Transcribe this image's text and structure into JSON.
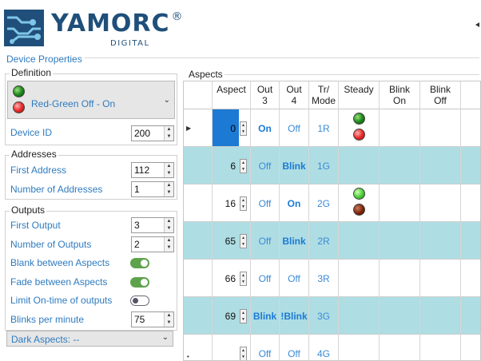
{
  "header": {
    "logo_text": "YAMORC",
    "logo_registered": "®",
    "logo_subtitle": "DIGITAL",
    "colors": {
      "brand": "#1f4f7a",
      "accent": "#2f7bbf"
    }
  },
  "device_properties": {
    "title": "Device Properties",
    "definition": {
      "title": "Definition",
      "selected": "Red-Green Off - On",
      "leds": [
        "green",
        "red"
      ],
      "device_id_label": "Device ID",
      "device_id_value": "200"
    },
    "addresses": {
      "title": "Addresses",
      "first_address_label": "First Address",
      "first_address_value": "112",
      "number_label": "Number of Addresses",
      "number_value": "1"
    },
    "outputs": {
      "title": "Outputs",
      "first_output_label": "First Output",
      "first_output_value": "3",
      "number_label": "Number of Outputs",
      "number_value": "2",
      "blank_label": "Blank between Aspects",
      "blank_on": true,
      "fade_label": "Fade between Aspects",
      "fade_on": true,
      "limit_label": "Limit On-time of outputs",
      "limit_on": false,
      "blinks_label": "Blinks per minute",
      "blinks_value": "75"
    },
    "dark_aspects": "Dark Aspects: --"
  },
  "aspects": {
    "title": "Aspects",
    "headers": {
      "aspect": "Aspect",
      "out3_a": "Out",
      "out3_b": "3",
      "out4_a": "Out",
      "out4_b": "4",
      "tr_a": "Tr/",
      "tr_b": "Mode",
      "steady": "Steady",
      "blink_on_a": "Blink",
      "blink_on_b": "On",
      "blink_off_a": "Blink",
      "blink_off_b": "Off"
    },
    "rows": [
      {
        "aspect": "0",
        "out3": "On",
        "out4": "Off",
        "tr": "1R",
        "steady": [
          "green",
          "red"
        ]
      },
      {
        "aspect": "6",
        "out3": "Off",
        "out4": "Blink",
        "tr": "1G",
        "steady": []
      },
      {
        "aspect": "16",
        "out3": "Off",
        "out4": "On",
        "tr": "2G",
        "steady": [
          "lgreen",
          "dred"
        ]
      },
      {
        "aspect": "65",
        "out3": "Off",
        "out4": "Blink",
        "tr": "2R",
        "steady": []
      },
      {
        "aspect": "66",
        "out3": "Off",
        "out4": "Off",
        "tr": "3R",
        "steady": []
      },
      {
        "aspect": "69",
        "out3": "Blink",
        "out4": "!Blink",
        "tr": "3G",
        "steady": []
      },
      {
        "aspect": "",
        "out3": "Off",
        "out4": "Off",
        "tr": "4G",
        "steady": []
      }
    ]
  }
}
